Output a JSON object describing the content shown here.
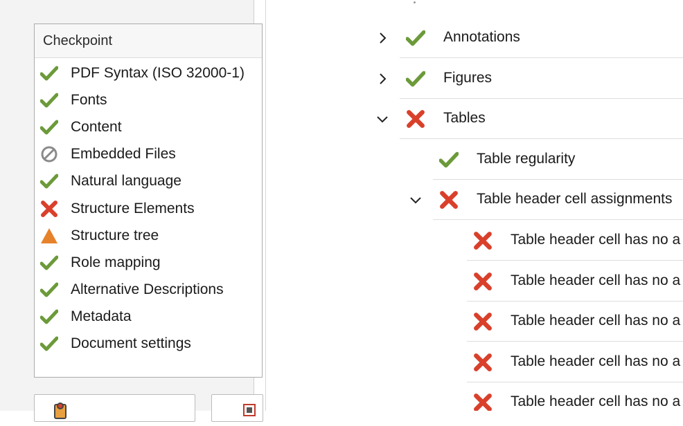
{
  "checkpoints": {
    "header": "Checkpoint",
    "items": [
      {
        "label": "PDF Syntax (ISO 32000-1)",
        "status": "pass",
        "icon": "check-icon"
      },
      {
        "label": "Fonts",
        "status": "pass",
        "icon": "check-icon"
      },
      {
        "label": "Content",
        "status": "pass",
        "icon": "check-icon"
      },
      {
        "label": "Embedded Files",
        "status": "not-applicable",
        "icon": "prohibited-icon"
      },
      {
        "label": "Natural language",
        "status": "pass",
        "icon": "check-icon"
      },
      {
        "label": "Structure Elements",
        "status": "fail",
        "icon": "cross-icon"
      },
      {
        "label": "Structure tree",
        "status": "warning",
        "icon": "warning-triangle-icon"
      },
      {
        "label": "Role mapping",
        "status": "pass",
        "icon": "check-icon"
      },
      {
        "label": "Alternative Descriptions",
        "status": "pass",
        "icon": "check-icon"
      },
      {
        "label": "Metadata",
        "status": "pass",
        "icon": "check-icon"
      },
      {
        "label": "Document settings",
        "status": "pass",
        "icon": "check-icon"
      }
    ]
  },
  "tree": {
    "rows": [
      {
        "label": "Annotations",
        "status": "pass",
        "expand": "collapsed",
        "level": 0
      },
      {
        "label": "Figures",
        "status": "pass",
        "expand": "collapsed",
        "level": 0
      },
      {
        "label": "Tables",
        "status": "fail",
        "expand": "expanded",
        "level": 0
      },
      {
        "label": "Table regularity",
        "status": "pass",
        "expand": "none",
        "level": 1
      },
      {
        "label": "Table header cell assignments",
        "status": "fail",
        "expand": "expanded",
        "level": 1
      },
      {
        "label": "Table header cell has no a",
        "status": "fail",
        "expand": "none",
        "level": 2
      },
      {
        "label": "Table header cell has no a",
        "status": "fail",
        "expand": "none",
        "level": 2
      },
      {
        "label": "Table header cell has no a",
        "status": "fail",
        "expand": "none",
        "level": 2
      },
      {
        "label": "Table header cell has no a",
        "status": "fail",
        "expand": "none",
        "level": 2
      },
      {
        "label": "Table header cell has no a",
        "status": "fail",
        "expand": "none",
        "level": 2
      }
    ]
  },
  "colors": {
    "pass": "#6c9a3a",
    "fail": "#d9402b",
    "warning": "#e6822a",
    "neutral": "#8a8a8a"
  }
}
